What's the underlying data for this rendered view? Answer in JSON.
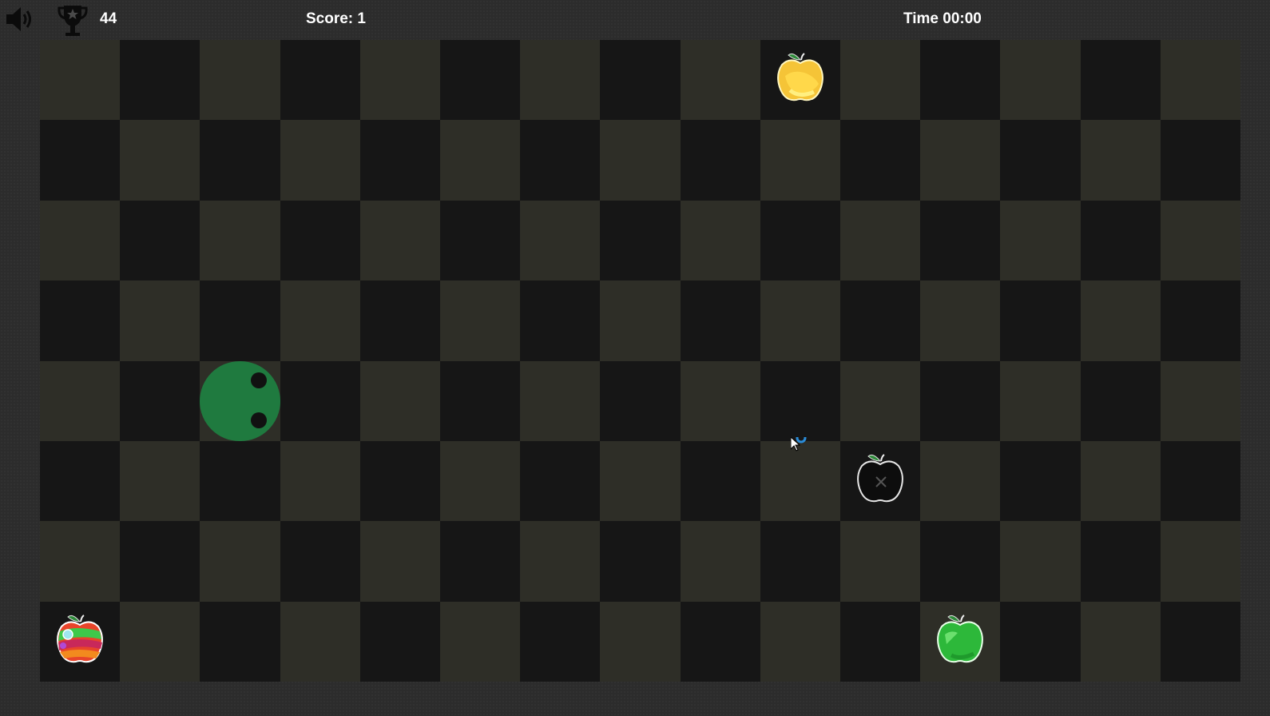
{
  "hud": {
    "sound_icon": "speaker-volume-icon",
    "trophy_icon": "trophy-icon",
    "best_score": "44",
    "score_text": "Score: 1",
    "time_text": "Time 00:00"
  },
  "board": {
    "columns": 15,
    "rows": 8,
    "colors": {
      "light": "#2e2e27",
      "dark": "#161616",
      "snake": "#1f7a3f"
    },
    "snake": [
      {
        "col": 2,
        "row": 4,
        "facing": "right"
      }
    ],
    "fruits": [
      {
        "kind": "golden-apple",
        "col": 9,
        "row": 0
      },
      {
        "kind": "black-apple",
        "col": 10,
        "row": 5
      },
      {
        "kind": "rainbow-apple",
        "col": 0,
        "row": 7
      },
      {
        "kind": "green-apple",
        "col": 11,
        "row": 7
      }
    ]
  }
}
